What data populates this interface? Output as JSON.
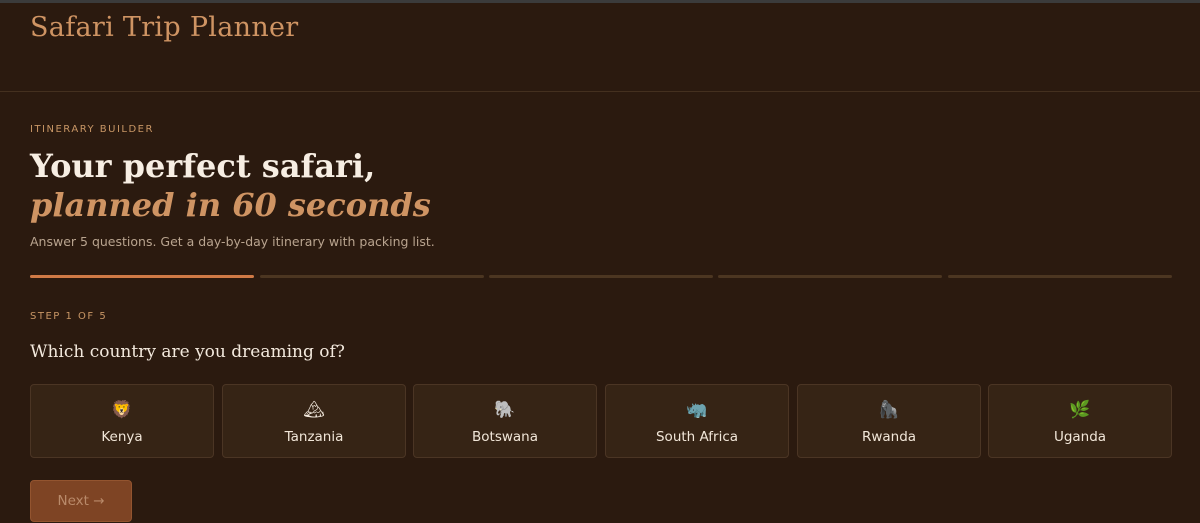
{
  "app": {
    "title": "Safari Trip Planner"
  },
  "hero": {
    "eyebrow": "ITINERARY BUILDER",
    "headline": "Your perfect safari,",
    "headline_accent": "planned in 60 seconds",
    "subhead": "Answer 5 questions. Get a day-by-day itinerary with packing list."
  },
  "progress": {
    "current_step": 1,
    "total_steps": 5
  },
  "step": {
    "label": "STEP 1 OF 5",
    "question": "Which country are you dreaming of?"
  },
  "options": [
    {
      "label": "Kenya",
      "icon": "lion-icon",
      "glyph": "🦁"
    },
    {
      "label": "Tanzania",
      "icon": "mountain-icon",
      "glyph": "🏔"
    },
    {
      "label": "Botswana",
      "icon": "elephant-icon",
      "glyph": "🐘"
    },
    {
      "label": "South Africa",
      "icon": "rhino-icon",
      "glyph": "🦏"
    },
    {
      "label": "Rwanda",
      "icon": "gorilla-icon",
      "glyph": "🦍"
    },
    {
      "label": "Uganda",
      "icon": "herb-icon",
      "glyph": "🌿"
    }
  ],
  "actions": {
    "next_label": "Next →"
  },
  "colors": {
    "background": "#2b1a0f",
    "accent": "#cf9463",
    "progress_active": "#d07a46",
    "card_background": "#362415",
    "button_background": "#7e4424"
  }
}
